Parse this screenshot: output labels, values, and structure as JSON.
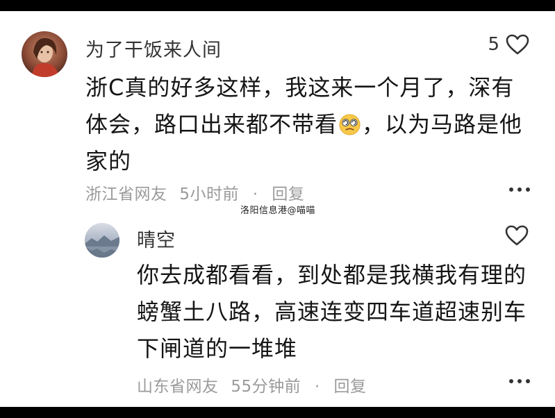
{
  "comment": {
    "username": "为了干饭来人间",
    "like_count": "5",
    "text_part1": "浙C真的好多这样，我这来一个月了，深有体会，路口出来都不带看",
    "emoji_name": "dizzy-face-emoji",
    "text_part2": "，以为马路是他家的",
    "location": "浙江省网友",
    "time": "5小时前",
    "separator": "·",
    "reply_label": "回复"
  },
  "watermark": "洛阳信息港@喵喵",
  "reply": {
    "username": "晴空",
    "text": "你去成都看看，到处都是我横我有理的螃蟹土八路，高速连变四车道超速别车下闸道的一堆堆",
    "location": "山东省网友",
    "time": "55分钟前",
    "separator": "·",
    "reply_label": "回复"
  },
  "icons": {
    "like": "heart-outline-icon",
    "more": "more-dots-icon"
  },
  "colors": {
    "background": "#ffffff",
    "frame": "#000000",
    "text_primary": "#151515",
    "text_meta": "#9a9a9a",
    "username": "#333333"
  }
}
